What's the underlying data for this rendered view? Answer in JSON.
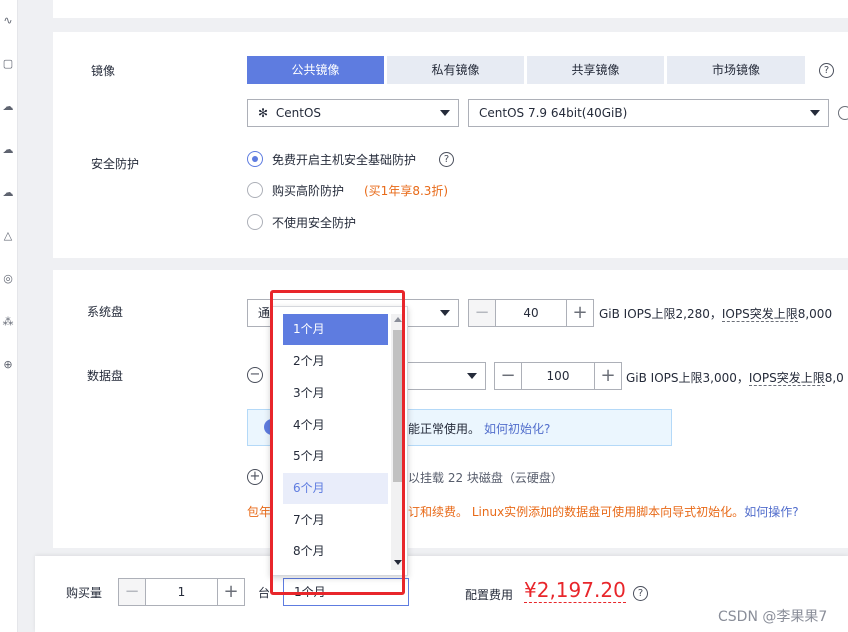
{
  "image": {
    "label": "镜像",
    "tabs": [
      "公共镜像",
      "私有镜像",
      "共享镜像",
      "市场镜像"
    ],
    "os_select": "CentOS",
    "version_select": "CentOS 7.9 64bit(40GiB)"
  },
  "security": {
    "label": "安全防护",
    "options": [
      "免费开启主机安全基础防护",
      "购买高阶防护",
      "不使用安全防护"
    ],
    "promo": "(买1年享8.3折)"
  },
  "system_disk": {
    "label": "系统盘",
    "type_visible": "通用型SSD",
    "size": "40",
    "iops_prefix": "GiB IOPS上限2,280，",
    "iops_burst": "IOPS突发上限",
    "iops_burst_value": "8,000"
  },
  "data_disk": {
    "label": "数据盘",
    "size": "100",
    "iops_prefix": "GiB IOPS上限3,000，",
    "iops_burst": "IOPS突发上限",
    "iops_burst_value": "8,0",
    "info_text": "能正常使用。",
    "info_link": "如何初始化?",
    "add_text": "以挂载 22 块磁盘（云硬盘）",
    "add_prefix": "增",
    "note_prefix": "包年",
    "note_mid": "订和续费。",
    "note_linux": "Linux实例添加的数据盘可使用脚本向导式初始化。",
    "note_link": "如何操作?"
  },
  "purchase": {
    "label": "购买量",
    "qty": "1",
    "unit": "台",
    "duration": "1个月",
    "fee_label": "配置费用",
    "fee": "¥2,197.20"
  },
  "dropdown": {
    "options": [
      "1个月",
      "2个月",
      "3个月",
      "4个月",
      "5个月",
      "6个月",
      "7个月",
      "8个月"
    ],
    "selected": 0,
    "hovered": 5
  },
  "watermark": "CSDN @李果果7",
  "colors": {
    "accent": "#5e7ce0",
    "price": "#e8262b",
    "highlight": "#e8262b"
  }
}
